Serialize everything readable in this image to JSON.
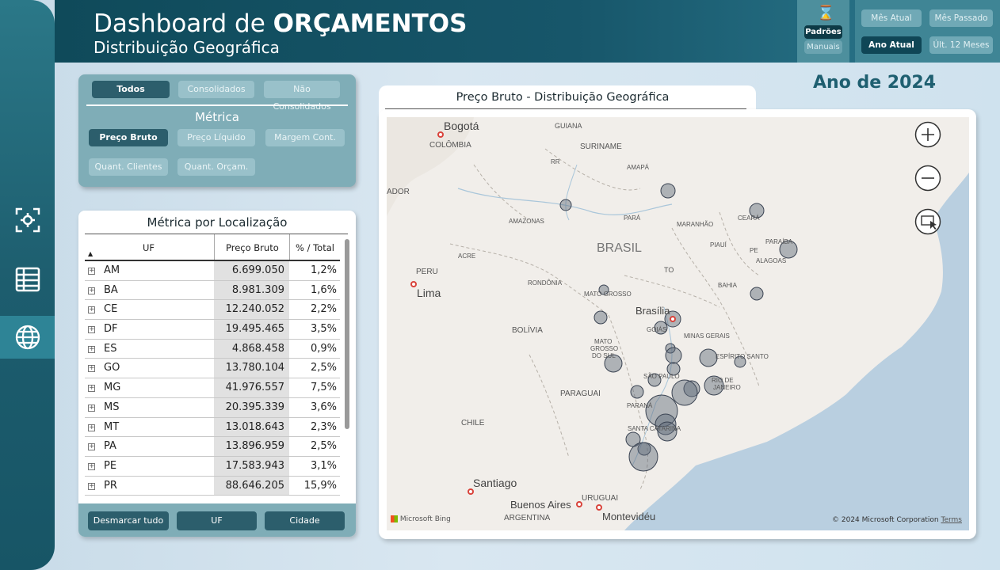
{
  "header": {
    "title_light": "Dashboard de ",
    "title_bold": "ORÇAMENTOS",
    "subtitle": "Distribuição Geográfica"
  },
  "mode": {
    "icon": "hourglass-icon",
    "active": "Padrões",
    "inactive": "Manuais"
  },
  "period": {
    "buttons": [
      "Mês Atual",
      "Mês Passado",
      "Ano Atual",
      "Últ. 12 Meses"
    ],
    "active": "Ano Atual"
  },
  "nav": {
    "items": [
      {
        "icon": "focus-scan-icon",
        "active": false
      },
      {
        "icon": "table-icon",
        "active": false
      },
      {
        "icon": "globe-icon",
        "active": true
      }
    ]
  },
  "filters": {
    "scope": [
      "Todos",
      "Consolidados",
      "Não Consolidados"
    ],
    "scope_active": "Todos",
    "metric_title": "Métrica",
    "metrics": [
      "Preço Bruto",
      "Preço Líquido",
      "Margem Cont.",
      "Quant. Clientes",
      "Quant. Orçam."
    ],
    "metric_active": "Preço Bruto"
  },
  "table": {
    "title": "Métrica por Localização",
    "columns": [
      "UF",
      "Preço Bruto",
      "% / Total"
    ],
    "rows": [
      {
        "uf": "AM",
        "value": "6.699.050",
        "pct": "1,2%"
      },
      {
        "uf": "BA",
        "value": "8.981.309",
        "pct": "1,6%"
      },
      {
        "uf": "CE",
        "value": "12.240.052",
        "pct": "2,2%"
      },
      {
        "uf": "DF",
        "value": "19.495.465",
        "pct": "3,5%"
      },
      {
        "uf": "ES",
        "value": "4.868.458",
        "pct": "0,9%"
      },
      {
        "uf": "GO",
        "value": "13.780.104",
        "pct": "2,5%"
      },
      {
        "uf": "MG",
        "value": "41.976.557",
        "pct": "7,5%"
      },
      {
        "uf": "MS",
        "value": "20.395.339",
        "pct": "3,6%"
      },
      {
        "uf": "MT",
        "value": "13.018.643",
        "pct": "2,3%"
      },
      {
        "uf": "PA",
        "value": "13.896.959",
        "pct": "2,5%"
      },
      {
        "uf": "PE",
        "value": "17.583.943",
        "pct": "3,1%"
      },
      {
        "uf": "PR",
        "value": "88.646.205",
        "pct": "15,9%"
      }
    ],
    "footer_buttons": [
      "Desmarcar tudo",
      "UF",
      "Cidade"
    ]
  },
  "map": {
    "year_label": "Ano de 2024",
    "title": "Preço Bruto - Distribuição Geográfica",
    "labels": [
      "Bogotá",
      "COLÔMBIA",
      "GUIANA",
      "SURINAME",
      "AMAPÁ",
      "RR",
      "ADOR",
      "AMAZONAS",
      "PARÁ",
      "MARANHÃO",
      "CEARÁ",
      "PARAÍBA",
      "PE",
      "ALAGOAS",
      "PIAUÍ",
      "BRASIL",
      "PERU",
      "ACRE",
      "Lima",
      "RONDÔNIA",
      "TO",
      "BAHIA",
      "MATO GROSSO",
      "Brasília",
      "GOIÁS",
      "MINAS GERAIS",
      "BOLÍVIA",
      "MATO",
      "GROSSO",
      "DO SUL",
      "ESPÍRITO SANTO",
      "SÃO PAULO",
      "RIO DE",
      "JANEIRO",
      "PARAGUAI",
      "PARANÁ",
      "SANTA CATARINA",
      "CHILE",
      "Santiago",
      "URUGUAI",
      "Buenos Aires",
      "ARGENTINA",
      "Montevidéu"
    ],
    "attribution": "© 2024 Microsoft Corporation",
    "terms": "Terms",
    "provider": "Microsoft Bing",
    "controls": [
      "zoom-in-icon",
      "zoom-out-icon",
      "select-region-icon"
    ]
  }
}
